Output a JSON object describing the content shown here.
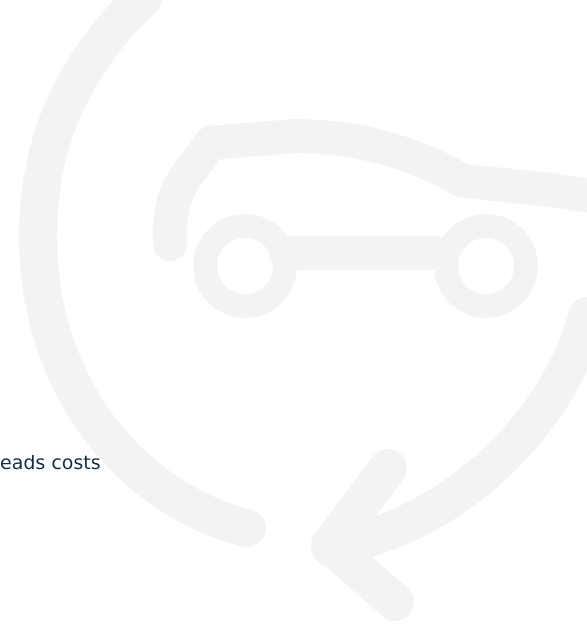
{
  "body_text": {
    "partial_line": "eads costs"
  },
  "colors": {
    "background": "#ffffff",
    "watermark": "#f3f3f3",
    "text": "#0f2f46"
  },
  "icons": {
    "watermark": "car-circular-arrow-icon"
  }
}
